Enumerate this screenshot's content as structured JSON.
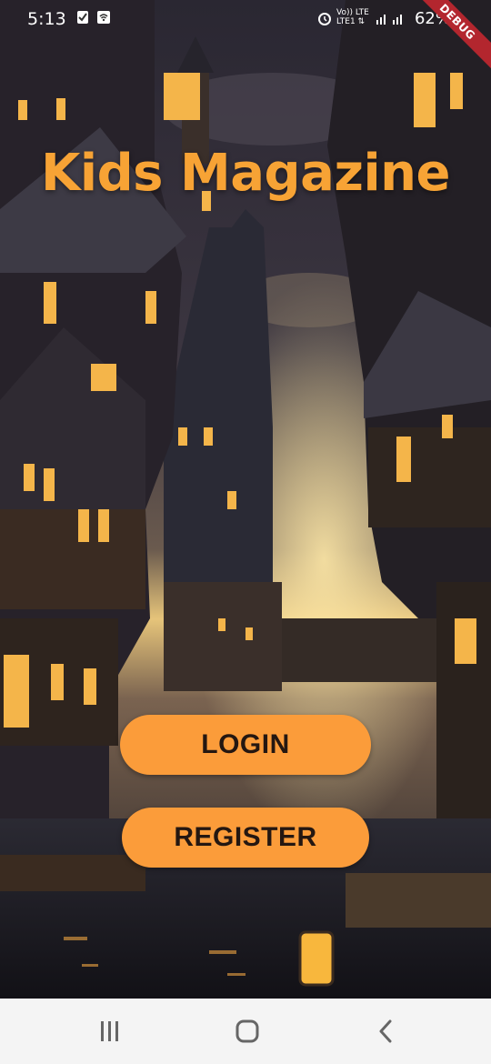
{
  "status_bar": {
    "time": "5:13",
    "battery": "62%",
    "network_label_top": "Vo)) LTE",
    "network_label_bottom": "LTE1 ⇅"
  },
  "debug_banner": "DEBUG",
  "app": {
    "title": "Kids Magazine",
    "login_label": "LOGIN",
    "register_label": "REGISTER"
  },
  "theme": {
    "accent": "#fb9c3a",
    "title_color": "#f7a335",
    "button_text": "#241711",
    "nav_bg": "#f4f4f4"
  },
  "nav": {
    "recent_icon": "recent-apps-icon",
    "home_icon": "home-icon",
    "back_icon": "back-icon"
  }
}
